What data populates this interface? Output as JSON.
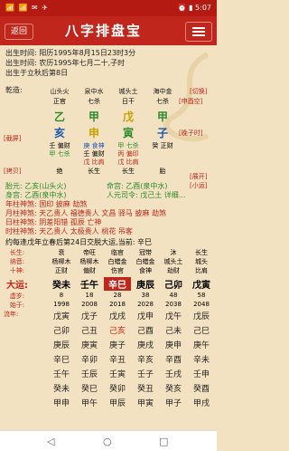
{
  "status": {
    "left": "📶 📶 ✉ ✈",
    "right": "⏰ ▮ 5:07"
  },
  "header": {
    "back": "返回",
    "title": "八字排盘宝",
    "menu": "menu-icon"
  },
  "birth": {
    "line1": "出生时间: 阳历1995年8月15日23时3分",
    "line2": "出生时间: 农历1995年七月二十,子时",
    "line3": "出生于立秋后第8日"
  },
  "pillars": {
    "labels": [
      "乾造:",
      "山头火",
      "泉中水",
      "城头土",
      "海中金"
    ],
    "tengod_top": [
      "正官",
      "七杀",
      "日干",
      "七杀"
    ],
    "stems": [
      "乙",
      "甲",
      "戊",
      "甲"
    ],
    "branches": [
      "亥",
      "申",
      "寅",
      "子"
    ],
    "hidden": [
      "壬 偏财",
      "庚 食神",
      "甲 七杀",
      "癸 正财"
    ],
    "hidden2": [
      "甲 七杀",
      "壬 偏财",
      "丙 偏印",
      ""
    ],
    "hidden3": [
      "",
      "戊 比肩",
      "戊 比肩",
      ""
    ],
    "stage": [
      "绝",
      "长生",
      "长生",
      "胎"
    ],
    "side": [
      "[申酉空]",
      "[切换]",
      "[晚子时]",
      "[截屏]",
      "[拷贝]",
      "[展开]",
      "[小运]"
    ]
  },
  "info": {
    "taiyuan": "胎元: 乙亥(山头火)",
    "minggong": "命宫: 乙酉(泉中水)",
    "shengong": "身宫: 乙酉(泉中水)",
    "yuanming": "人元司令: 戊己土 详细...",
    "shensha1": "年柱神煞: 国印 披麻 劫煞",
    "shensha2": "月柱神煞: 天乙贵人 福德贵人 文昌 驿马 披麻 劫煞",
    "shensha3": "日柱神煞: 阴差阳错 孤辰 亡神",
    "shensha4": "时柱神煞: 天乙贵人 太极贵人 桃花 吊客",
    "qiyun": "约每逢戊年立春后第24日交脱大运,当前: 辛巳"
  },
  "dayun": {
    "changsheng": [
      "长生:",
      "衰",
      "帝旺",
      "临官",
      "冠带",
      "沐",
      "长生"
    ],
    "nayin": [
      "纳音:",
      "杨柳木",
      "杨柳木",
      "白蜡金",
      "白蜡金",
      "城头土",
      "城头"
    ],
    "tengod": [
      "十神:",
      "正财",
      "偏财",
      "伤官",
      "食神",
      "劫财",
      "比肩"
    ],
    "dayun": [
      "大运:",
      "癸未",
      "壬午",
      "辛巳",
      "庚辰",
      "己卯",
      "戊寅"
    ],
    "xusui": [
      "虚岁:",
      "8",
      "18",
      "28",
      "38",
      "48",
      "58"
    ],
    "start": [
      "始于:",
      "1998",
      "2008",
      "2018",
      "2028",
      "2038",
      "2048"
    ]
  },
  "liunian": {
    "label": "流年:",
    "cols": [
      [
        "戊寅",
        "戊子",
        "戊戌",
        "戊申",
        "戊午",
        "戊辰"
      ],
      [
        "己卯",
        "己丑",
        "己亥",
        "己酉",
        "己未",
        "己巳"
      ],
      [
        "庚辰",
        "庚寅",
        "庚子",
        "庚戌",
        "庚申",
        "庚午"
      ],
      [
        "辛巳",
        "辛卯",
        "辛丑",
        "辛亥",
        "辛酉",
        "辛未"
      ],
      [
        "壬午",
        "壬辰",
        "壬寅",
        "壬子",
        "壬戌",
        "壬申"
      ],
      [
        "癸未",
        "癸巳",
        "癸卯",
        "癸丑",
        "癸亥",
        "癸酉"
      ],
      [
        "甲申",
        "甲午",
        "甲辰",
        "甲寅",
        "甲子",
        "甲戌"
      ]
    ]
  },
  "bottomnav": {
    "back": "◁",
    "home": "○",
    "recent": "□"
  }
}
